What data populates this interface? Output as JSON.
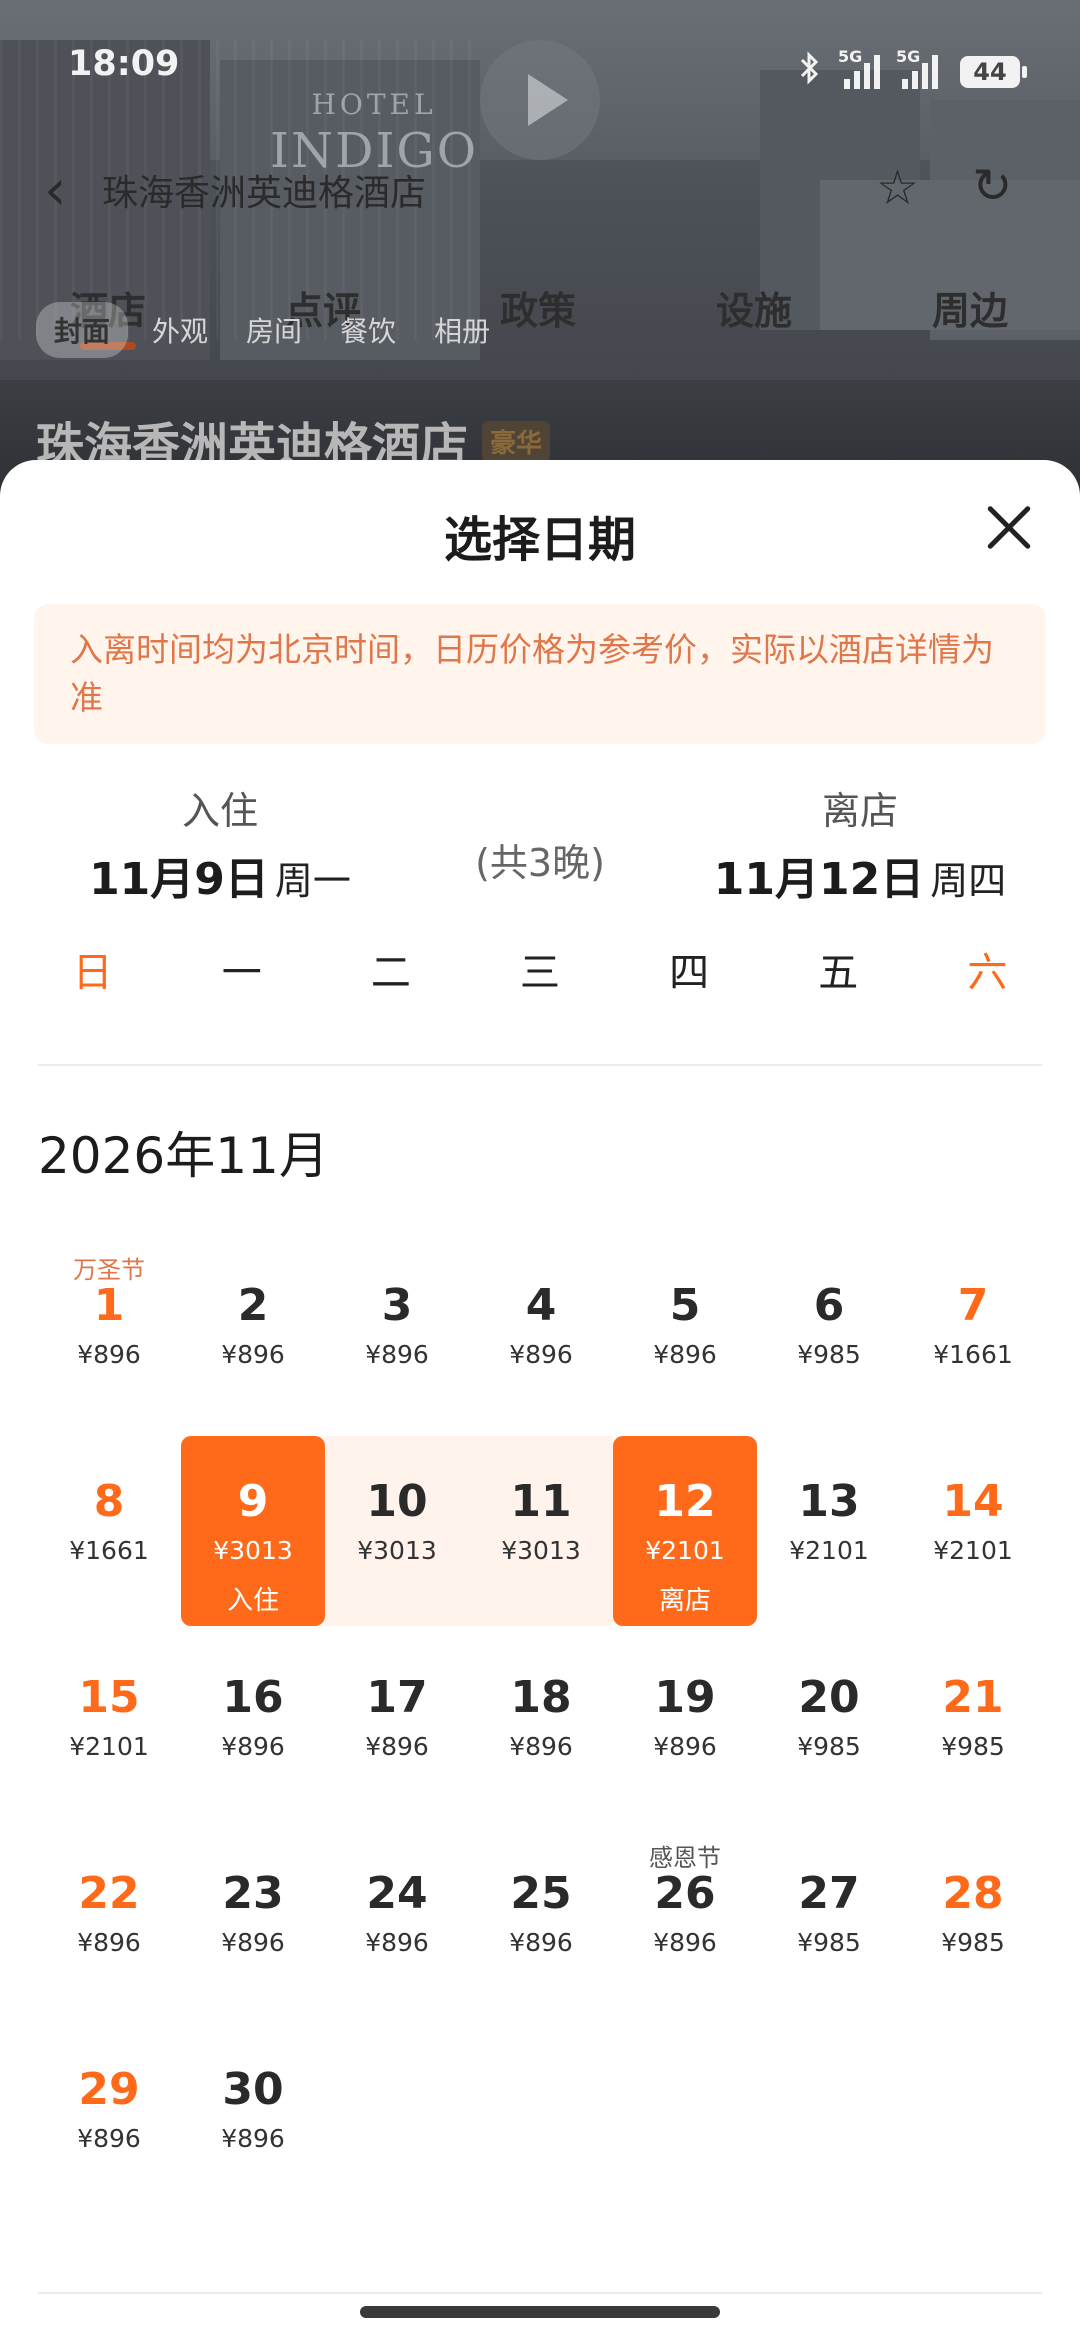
{
  "status_bar": {
    "time": "18:09",
    "signal1_tag": "5G",
    "signal2_tag": "5G",
    "battery": "44"
  },
  "hotel_header": {
    "logo_line1": "HOTEL",
    "logo_line2": "INDIGO",
    "nav_title": "珠海香洲英迪格酒店",
    "tabs": [
      "酒店",
      "点评",
      "政策",
      "设施",
      "周边"
    ],
    "photo_chips": [
      "封面",
      "外观",
      "房间",
      "餐饮",
      "相册"
    ],
    "hotel_name": "珠海香洲英迪格酒店",
    "badge": "豪华"
  },
  "sheet": {
    "title": "选择日期",
    "notice": "入离时间均为北京时间，日历价格为参考价，实际以酒店详情为准",
    "checkin": {
      "label": "入住",
      "date": "11月9日",
      "weekday": "周一"
    },
    "nights": "(共3晚)",
    "checkout": {
      "label": "离店",
      "date": "11月12日",
      "weekday": "周四"
    },
    "weekdays": [
      "日",
      "一",
      "二",
      "三",
      "四",
      "五",
      "六"
    ],
    "month_label": "2026年11月",
    "first_weekday_index": 0,
    "days": [
      {
        "day": "1",
        "price": "¥896",
        "holiday": "万圣节"
      },
      {
        "day": "2",
        "price": "¥896"
      },
      {
        "day": "3",
        "price": "¥896"
      },
      {
        "day": "4",
        "price": "¥896"
      },
      {
        "day": "5",
        "price": "¥896"
      },
      {
        "day": "6",
        "price": "¥985"
      },
      {
        "day": "7",
        "price": "¥1661"
      },
      {
        "day": "8",
        "price": "¥1661"
      },
      {
        "day": "9",
        "price": "¥3013",
        "state": "checkin",
        "sub": "入住"
      },
      {
        "day": "10",
        "price": "¥3013",
        "state": "in-range"
      },
      {
        "day": "11",
        "price": "¥3013",
        "state": "in-range"
      },
      {
        "day": "12",
        "price": "¥2101",
        "state": "checkout",
        "sub": "离店"
      },
      {
        "day": "13",
        "price": "¥2101"
      },
      {
        "day": "14",
        "price": "¥2101"
      },
      {
        "day": "15",
        "price": "¥2101"
      },
      {
        "day": "16",
        "price": "¥896"
      },
      {
        "day": "17",
        "price": "¥896"
      },
      {
        "day": "18",
        "price": "¥896"
      },
      {
        "day": "19",
        "price": "¥896"
      },
      {
        "day": "20",
        "price": "¥985"
      },
      {
        "day": "21",
        "price": "¥985"
      },
      {
        "day": "22",
        "price": "¥896"
      },
      {
        "day": "23",
        "price": "¥896"
      },
      {
        "day": "24",
        "price": "¥896"
      },
      {
        "day": "25",
        "price": "¥896"
      },
      {
        "day": "26",
        "price": "¥896",
        "holiday": "感恩节"
      },
      {
        "day": "27",
        "price": "¥985"
      },
      {
        "day": "28",
        "price": "¥985"
      },
      {
        "day": "29",
        "price": "¥896"
      },
      {
        "day": "30",
        "price": "¥896"
      }
    ]
  },
  "colors": {
    "accent": "#ff6a1a",
    "range_fill": "#fff3ec",
    "notice_bg": "#fff5ed",
    "notice_text": "#e0774a"
  }
}
